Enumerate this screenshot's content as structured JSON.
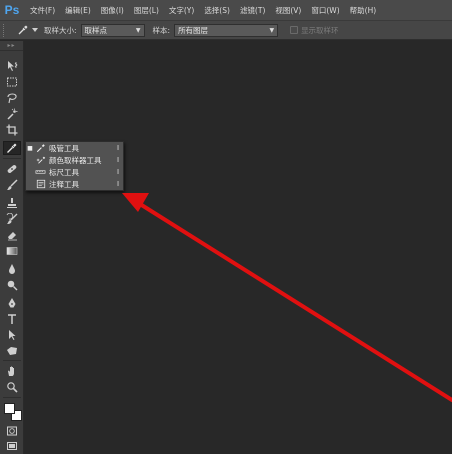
{
  "app": {
    "logo": "Ps"
  },
  "menubar": {
    "items": [
      {
        "label": "文件(F)"
      },
      {
        "label": "编辑(E)"
      },
      {
        "label": "图像(I)"
      },
      {
        "label": "图层(L)"
      },
      {
        "label": "文字(Y)"
      },
      {
        "label": "选择(S)"
      },
      {
        "label": "滤镜(T)"
      },
      {
        "label": "视图(V)"
      },
      {
        "label": "窗口(W)"
      },
      {
        "label": "帮助(H)"
      }
    ]
  },
  "options": {
    "sample_size_label": "取样大小:",
    "sample_size_value": "取样点",
    "sample_label": "样本:",
    "sample_value": "所有图层",
    "show_ring_label": "显示取样环",
    "show_ring_checked": false
  },
  "flyout": {
    "items": [
      {
        "label": "吸管工具",
        "shortcut": "I",
        "icon": "eyedropper-icon",
        "selected": true
      },
      {
        "label": "颜色取样器工具",
        "shortcut": "I",
        "icon": "color-sampler-icon",
        "selected": false
      },
      {
        "label": "标尺工具",
        "shortcut": "I",
        "icon": "ruler-icon",
        "selected": false
      },
      {
        "label": "注释工具",
        "shortcut": "I",
        "icon": "note-icon",
        "selected": false
      }
    ]
  },
  "toolbar": {
    "tools": [
      "move-tool-icon",
      "marquee-tool-icon",
      "lasso-tool-icon",
      "quick-select-tool-icon",
      "crop-tool-icon",
      "eyedropper-tool-icon",
      "healing-brush-tool-icon",
      "brush-tool-icon",
      "clone-stamp-tool-icon",
      "history-brush-tool-icon",
      "eraser-tool-icon",
      "gradient-tool-icon",
      "blur-tool-icon",
      "dodge-tool-icon",
      "pen-tool-icon",
      "type-tool-icon",
      "path-select-tool-icon",
      "shape-tool-icon",
      "hand-tool-icon",
      "zoom-tool-icon"
    ]
  },
  "colors": {
    "annotation_arrow": "#e01010",
    "foreground": "#ffffff",
    "background": "#ffffff"
  }
}
